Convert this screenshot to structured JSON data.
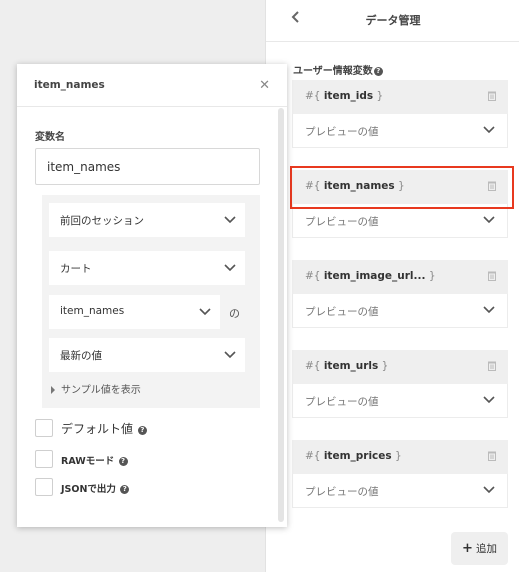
{
  "header": {
    "title": "データ管理"
  },
  "section": {
    "title": "ユーザー情報変数"
  },
  "variables": [
    {
      "name": "item_ids",
      "preview": "プレビューの値"
    },
    {
      "name": "item_names",
      "preview": "プレビューの値"
    },
    {
      "name": "item_image_url...",
      "preview": "プレビューの値"
    },
    {
      "name": "item_urls",
      "preview": "プレビューの値"
    },
    {
      "name": "item_prices",
      "preview": "プレビューの値"
    }
  ],
  "add_button": {
    "label": "追加"
  },
  "modal": {
    "title": "item_names",
    "var_name_label": "変数名",
    "var_name_value": "item_names",
    "selects": {
      "session": "前回のセッション",
      "source": "カート",
      "field": "item_names",
      "field_suffix": "の",
      "aggregate": "最新の値"
    },
    "sample_toggle": "サンプル値を表示",
    "default_value": "デフォルト値",
    "raw_mode": "RAWモード",
    "json_output": "JSONで出力"
  },
  "colors": {
    "highlight": "#e8391f",
    "panel_bg": "#eeeeee"
  }
}
